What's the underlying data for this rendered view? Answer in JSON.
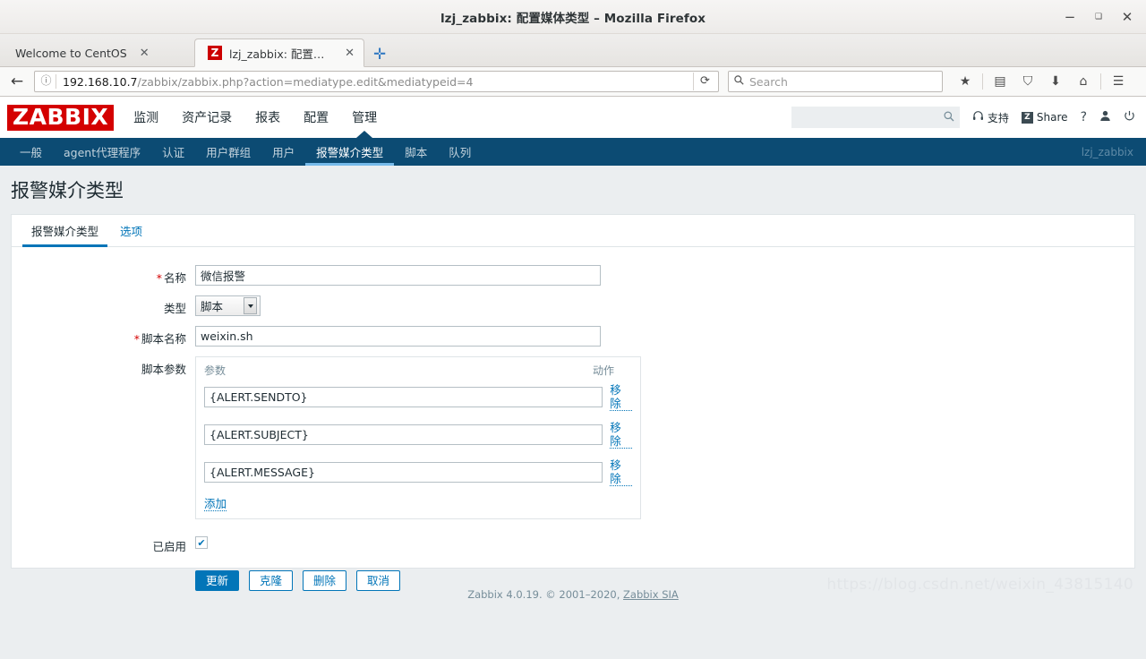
{
  "browser": {
    "window_title": "lzj_zabbix: 配置媒体类型 – Mozilla Firefox",
    "window_buttons": {
      "minimize": "−",
      "maximize": "❑",
      "close": "✕"
    },
    "tabs": [
      {
        "label": "Welcome to CentOS",
        "close": "✕",
        "favicon": "",
        "active": false
      },
      {
        "label": "lzj_zabbix: 配置媒体...",
        "close": "✕",
        "favicon": "Z",
        "active": true
      }
    ],
    "new_tab_label": "✛",
    "back_arrow": "←",
    "identity_icon": "ⓘ",
    "url_host": "192.168.10.7",
    "url_path": "/zabbix/zabbix.php?action=mediatype.edit&mediatypeid=4",
    "reload_icon": "⟳",
    "search_placeholder": "Search",
    "search_value": "",
    "search_icon": "🔍",
    "nav_icons": [
      "★",
      "▤",
      "⛉",
      "⬇",
      "⌂",
      "☰"
    ]
  },
  "zabbix": {
    "logo": "ZABBIX",
    "main_nav": [
      {
        "label": "监测",
        "active": false
      },
      {
        "label": "资产记录",
        "active": false
      },
      {
        "label": "报表",
        "active": false
      },
      {
        "label": "配置",
        "active": false
      },
      {
        "label": "管理",
        "active": true
      }
    ],
    "header_search_value": "",
    "header_search_placeholder": "",
    "support_label": "支持",
    "share_label": "Share",
    "share_badge": "Z",
    "help_label": "?",
    "profile_icon": "user-icon",
    "signout_icon": "power-icon",
    "sub_nav": [
      {
        "label": "一般",
        "active": false
      },
      {
        "label": "agent代理程序",
        "active": false
      },
      {
        "label": "认证",
        "active": false
      },
      {
        "label": "用户群组",
        "active": false
      },
      {
        "label": "用户",
        "active": false
      },
      {
        "label": "报警媒介类型",
        "active": true
      },
      {
        "label": "脚本",
        "active": false
      },
      {
        "label": "队列",
        "active": false
      }
    ],
    "logged_user": "lzj_zabbix",
    "page_title": "报警媒介类型",
    "tabs": [
      {
        "label": "报警媒介类型",
        "active": true
      },
      {
        "label": "选项",
        "active": false
      }
    ],
    "form": {
      "name_label": "名称",
      "name_value": "微信报警",
      "name_required": "*",
      "type_label": "类型",
      "type_value": "脚本",
      "script_name_label": "脚本名称",
      "script_name_value": "weixin.sh",
      "script_name_required": "*",
      "script_params_label": "脚本参数",
      "param_col_header": "参数",
      "action_col_header": "动作",
      "params": [
        {
          "value": "{ALERT.SENDTO}",
          "remove_label": "移除"
        },
        {
          "value": "{ALERT.SUBJECT}",
          "remove_label": "移除"
        },
        {
          "value": "{ALERT.MESSAGE}",
          "remove_label": "移除"
        }
      ],
      "add_label": "添加",
      "enabled_label": "已启用",
      "enabled_checked": "✔"
    },
    "buttons": [
      {
        "label": "更新",
        "primary": true
      },
      {
        "label": "克隆",
        "primary": false
      },
      {
        "label": "删除",
        "primary": false
      },
      {
        "label": "取消",
        "primary": false
      }
    ],
    "footer_text": "Zabbix 4.0.19. © 2001–2020,",
    "footer_link": "Zabbix SIA",
    "watermark": "https://blog.csdn.net/weixin_43815140"
  },
  "colors": {
    "zabbix_red": "#d40000",
    "zabbix_navy": "#0c4b73",
    "zabbix_blue": "#0275b8",
    "zabbix_accent": "#76baea",
    "page_bg": "#ebeef0"
  }
}
